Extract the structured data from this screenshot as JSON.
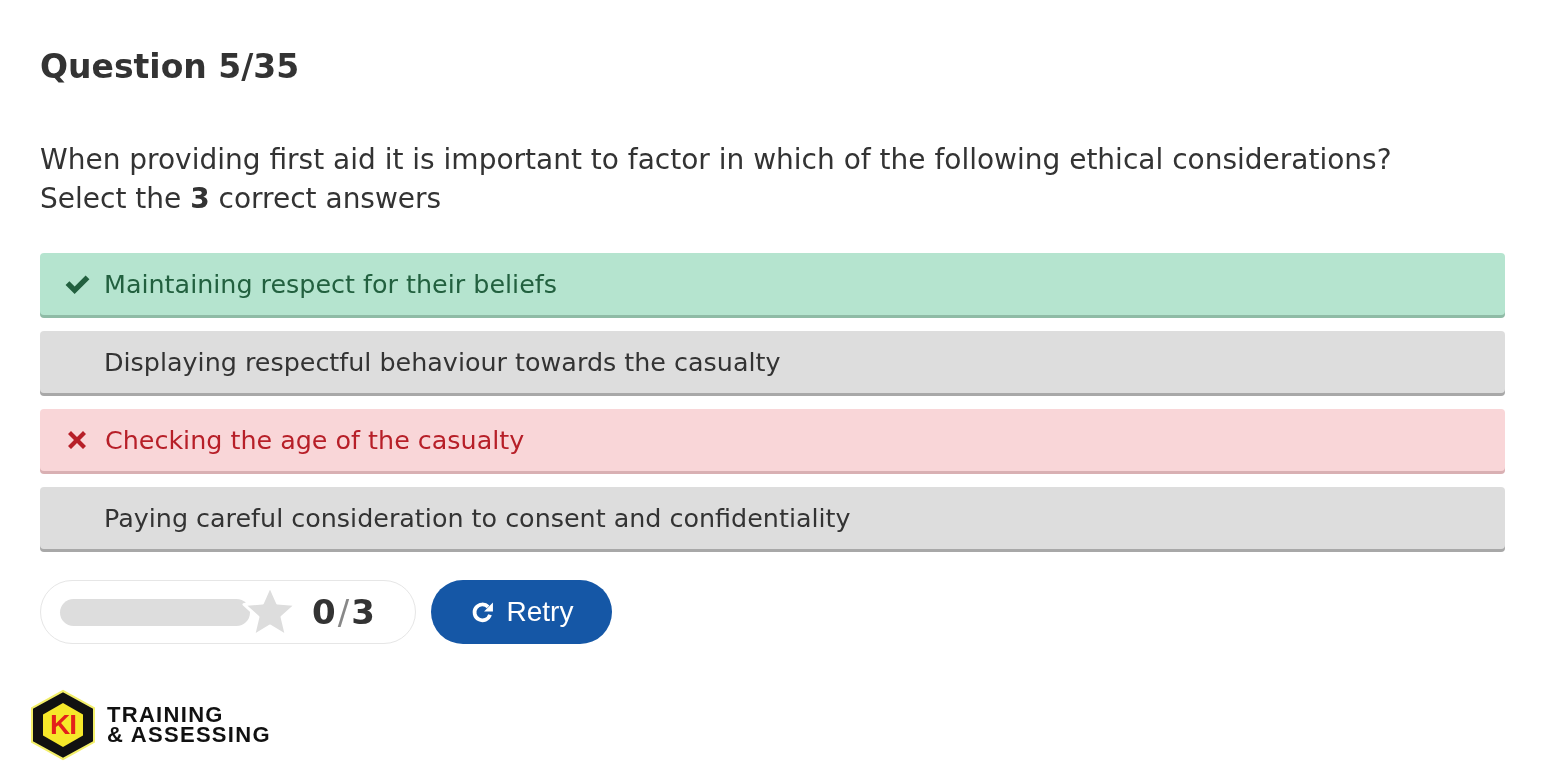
{
  "title": "Question 5/35",
  "question": {
    "text": "When providing first aid it is important to factor in which of the following ethical considerations?",
    "instruction": "Select the **3** correct answers"
  },
  "answers": [
    {
      "label": "Maintaining respect for their beliefs",
      "kind": "correct"
    },
    {
      "label": "Displaying respectful behaviour towards the casualty",
      "kind": "plain"
    },
    {
      "label": "Checking the age of the casualty",
      "kind": "wrong"
    },
    {
      "label": "Paying careful consideration to consent and confidentiality",
      "kind": "plain"
    }
  ],
  "score": {
    "level": 0,
    "earned": "0",
    "separator": "/",
    "total": "3"
  },
  "retry_button": {
    "label": "Retry"
  },
  "logo": {
    "mark": "KI",
    "lines": [
      "TRAINING",
      "& ASSESSING"
    ]
  }
}
